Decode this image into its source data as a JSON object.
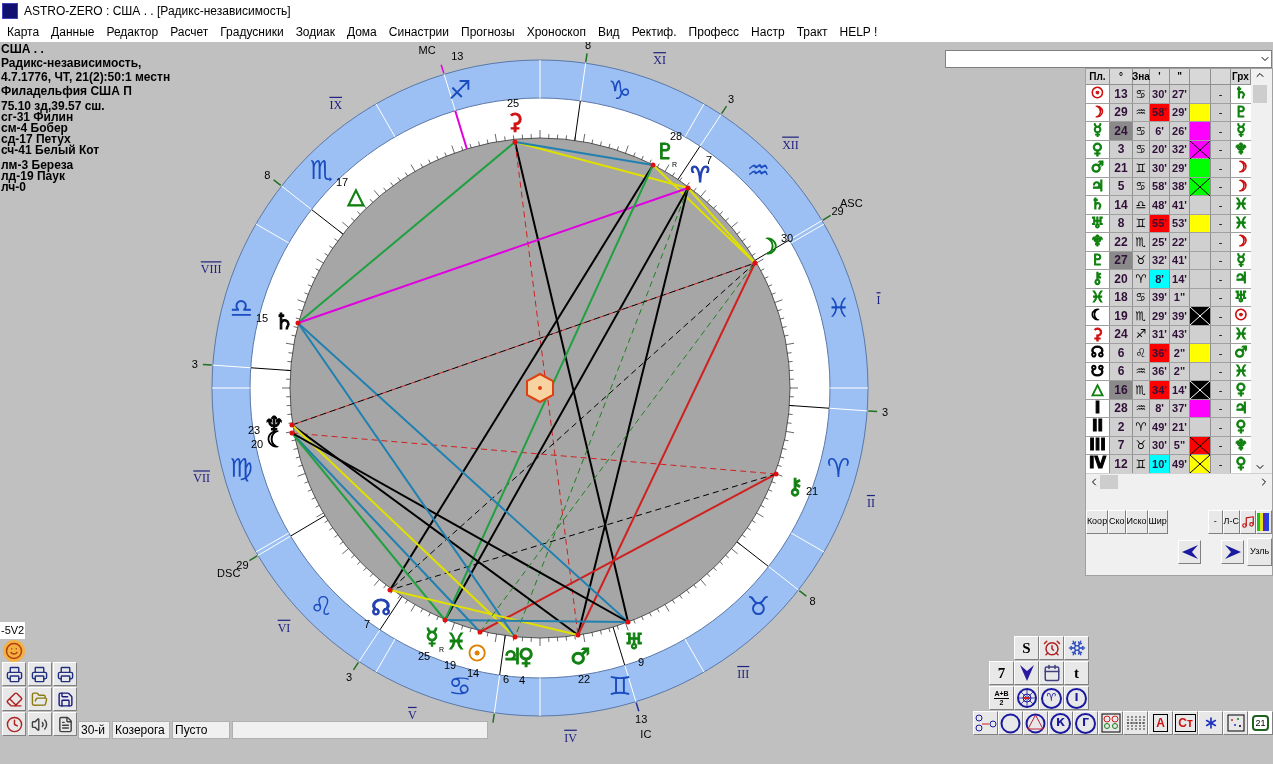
{
  "window": {
    "title": "ASTRO-ZERO : США . . [Радикс-независимость]"
  },
  "menu": [
    "Карта",
    "Данные",
    "Редактор",
    "Расчет",
    "Градусники",
    "Зодиак",
    "Дома",
    "Синастрии",
    "Прогнозы",
    "Хроноскоп",
    "Вид",
    "Ректиф.",
    "Професс",
    "Настр",
    "Тракт",
    "HELP !"
  ],
  "chart_info": {
    "blocks": [
      [
        "США . .",
        "Радикс-независимость,",
        "4.7.1776, ЧТ, 21(2):50:1 местн",
        "Филадельфия США П"
      ],
      [
        "75.10 зд,39.57 сш.",
        "сг-31 Филин",
        "см-4 Бобер",
        "сд-17 Петух",
        "сч-41 Белый Кот"
      ],
      [
        "лм-3 Береза",
        "лд-19 Паук",
        "лч-0"
      ]
    ]
  },
  "wheel": {
    "signs": [
      "♓",
      "♒",
      "♑",
      "♐",
      "♏",
      "♎",
      "♍",
      "♌",
      "♋",
      "♊",
      "♉",
      "♈"
    ],
    "houses": [
      "I",
      "II",
      "III",
      "IV",
      "V",
      "VI",
      "VII",
      "VIII",
      "IX",
      "XI",
      "XII"
    ],
    "cusps": [
      {
        "degree": "29",
        "angle": "ASC"
      },
      {
        "degree": "3"
      },
      {
        "degree": "8"
      },
      {
        "degree": "13",
        "angle": "MC"
      },
      {
        "degree": "8"
      },
      {
        "degree": "3"
      },
      {
        "degree": "29",
        "angle": "DSC"
      },
      {
        "degree": "3"
      },
      {
        "degree": "13",
        "angle": "IC"
      },
      {
        "degree": "8"
      },
      {
        "degree": "3"
      }
    ],
    "planets": [
      {
        "glyph": "⚳",
        "degree": "25",
        "color": "#d01010"
      },
      {
        "glyph": "♇",
        "degree": "28",
        "color": "#108010",
        "mark": "R"
      },
      {
        "glyph": "♈",
        "degree": "7",
        "color": "#2040b0"
      },
      {
        "glyph": "△",
        "degree": "17",
        "color": "#108010"
      },
      {
        "glyph": "☽",
        "degree": "30",
        "color": "#108010"
      },
      {
        "glyph": "♄",
        "degree": "15",
        "color": "#000000"
      },
      {
        "glyph": "♆",
        "degree": "23",
        "color": "#000000"
      },
      {
        "glyph": "☾",
        "degree": "20",
        "color": "#000000"
      },
      {
        "glyph": "⚷",
        "degree": "21",
        "color": "#108010"
      },
      {
        "glyph": "☊",
        "degree": "7",
        "color": "#2040b0"
      },
      {
        "glyph": "☿",
        "degree": "25",
        "color": "#108010",
        "mark": "R"
      },
      {
        "glyph": "♓",
        "degree": "19",
        "color": "#108010"
      },
      {
        "glyph": "☉",
        "degree": "14",
        "color": "#e08000"
      },
      {
        "glyph": "♃",
        "degree": "6",
        "color": "#108010"
      },
      {
        "glyph": "♀",
        "degree": "4",
        "color": "#108010"
      },
      {
        "glyph": "♂",
        "degree": "22",
        "color": "#108010"
      },
      {
        "glyph": "♅",
        "degree": "9",
        "color": "#108010"
      }
    ]
  },
  "planet_table": {
    "columns": [
      "Пл.",
      "°",
      "Зна",
      "'",
      "\"",
      "Грх"
    ],
    "rows": [
      {
        "planet": {
          "glyph": "☉",
          "color": "#d01010"
        },
        "degree": {
          "text": "13",
          "marked": false
        },
        "sign": "♋",
        "minutes": {
          "text": "30'"
        },
        "seconds": "27'",
        "dash": "-",
        "aspect": {
          "glyph": "♄",
          "color": "#108010"
        }
      },
      {
        "planet": {
          "glyph": "☽",
          "color": "#d01010"
        },
        "degree": {
          "text": "29",
          "marked": false
        },
        "sign": "♒",
        "minutes": {
          "text": "58'",
          "color": "#ff0000"
        },
        "seconds": "29'",
        "marker": {
          "color": "#ffff00",
          "crossed": false
        },
        "dash": "-",
        "aspect": {
          "glyph": "♇",
          "color": "#108010"
        }
      },
      {
        "planet": {
          "glyph": "☿",
          "color": "#108010"
        },
        "degree": {
          "text": "24",
          "marked": true
        },
        "sign": "♋",
        "minutes": {
          "text": "6'"
        },
        "seconds": "26'",
        "marker": {
          "color": "#ff00ff",
          "crossed": false
        },
        "dash": "-",
        "aspect": {
          "glyph": "☿",
          "color": "#108010"
        }
      },
      {
        "planet": {
          "glyph": "♀",
          "color": "#108010"
        },
        "degree": {
          "text": "3",
          "marked": false
        },
        "sign": "♋",
        "minutes": {
          "text": "20'"
        },
        "seconds": "32'",
        "marker": {
          "color": "#ff00ff",
          "crossed": true
        },
        "dash": "-",
        "aspect": {
          "glyph": "♆",
          "color": "#108010"
        }
      },
      {
        "planet": {
          "glyph": "♂",
          "color": "#108010"
        },
        "degree": {
          "text": "21",
          "marked": false
        },
        "sign": "♊",
        "minutes": {
          "text": "30'"
        },
        "seconds": "29'",
        "marker": {
          "color": "#00ff00",
          "crossed": false
        },
        "dash": "-",
        "aspect": {
          "glyph": "☽",
          "color": "#d01010"
        }
      },
      {
        "planet": {
          "glyph": "♃",
          "color": "#108010"
        },
        "degree": {
          "text": "5",
          "marked": false
        },
        "sign": "♋",
        "minutes": {
          "text": "58'"
        },
        "seconds": "38'",
        "marker": {
          "color": "#00ff00",
          "crossed": true
        },
        "dash": "-",
        "aspect": {
          "glyph": "☽",
          "color": "#d01010"
        }
      },
      {
        "planet": {
          "glyph": "♄",
          "color": "#108010"
        },
        "degree": {
          "text": "14",
          "marked": false
        },
        "sign": "♎",
        "minutes": {
          "text": "48'"
        },
        "seconds": "41'",
        "dash": "-",
        "aspect": {
          "glyph": "♓",
          "color": "#108010"
        }
      },
      {
        "planet": {
          "glyph": "♅",
          "color": "#108010"
        },
        "degree": {
          "text": "8",
          "marked": false
        },
        "sign": "♊",
        "minutes": {
          "text": "55'",
          "color": "#ff0000"
        },
        "seconds": "53'",
        "marker": {
          "color": "#ffff00",
          "crossed": false
        },
        "dash": "-",
        "aspect": {
          "glyph": "♓",
          "color": "#108010"
        }
      },
      {
        "planet": {
          "glyph": "♆",
          "color": "#108010"
        },
        "degree": {
          "text": "22",
          "marked": false
        },
        "sign": "♏",
        "minutes": {
          "text": "25'"
        },
        "seconds": "22'",
        "dash": "-",
        "aspect": {
          "glyph": "☽",
          "color": "#d01010"
        }
      },
      {
        "planet": {
          "glyph": "♇",
          "color": "#108010"
        },
        "degree": {
          "text": "27",
          "marked": true
        },
        "sign": "♉",
        "minutes": {
          "text": "32'"
        },
        "seconds": "41'",
        "dash": "-",
        "aspect": {
          "glyph": "☿",
          "color": "#108010"
        }
      },
      {
        "planet": {
          "glyph": "⚷",
          "color": "#108010"
        },
        "degree": {
          "text": "20",
          "marked": false
        },
        "sign": "♈",
        "minutes": {
          "text": "8'",
          "color": "#00ffff"
        },
        "seconds": "14'",
        "dash": "-",
        "aspect": {
          "glyph": "♃",
          "color": "#108010"
        }
      },
      {
        "planet": {
          "glyph": "♓",
          "color": "#108010"
        },
        "degree": {
          "text": "18",
          "marked": false
        },
        "sign": "♋",
        "minutes": {
          "text": "39'"
        },
        "seconds": "1\"",
        "dash": "-",
        "aspect": {
          "glyph": "♅",
          "color": "#108010"
        }
      },
      {
        "planet": {
          "glyph": "☾",
          "color": "#000000"
        },
        "degree": {
          "text": "19",
          "marked": false
        },
        "sign": "♏",
        "minutes": {
          "text": "29'"
        },
        "seconds": "39'",
        "marker": {
          "color": "#000000",
          "crossed": true
        },
        "dash": "-",
        "aspect": {
          "glyph": "☉",
          "color": "#d01010"
        }
      },
      {
        "planet": {
          "glyph": "⚳",
          "color": "#d01010"
        },
        "degree": {
          "text": "24",
          "marked": false
        },
        "sign": "♐",
        "minutes": {
          "text": "31'"
        },
        "seconds": "43'",
        "dash": "-",
        "aspect": {
          "glyph": "♓",
          "color": "#108010"
        }
      },
      {
        "planet": {
          "glyph": "☊",
          "color": "#000000"
        },
        "degree": {
          "text": "6",
          "marked": false
        },
        "sign": "♌",
        "minutes": {
          "text": "36'",
          "color": "#ff0000"
        },
        "seconds": "2\"",
        "marker": {
          "color": "#ffff00",
          "crossed": false
        },
        "dash": "-",
        "aspect": {
          "glyph": "♂",
          "color": "#108010"
        }
      },
      {
        "planet": {
          "glyph": "☋",
          "color": "#000000"
        },
        "degree": {
          "text": "6",
          "marked": false
        },
        "sign": "♒",
        "minutes": {
          "text": "36'"
        },
        "seconds": "2\"",
        "dash": "-",
        "aspect": {
          "glyph": "♓",
          "color": "#108010"
        }
      },
      {
        "planet": {
          "glyph": "△",
          "color": "#108010"
        },
        "degree": {
          "text": "16",
          "marked": true
        },
        "sign": "♏",
        "minutes": {
          "text": "34'",
          "color": "#ff0000"
        },
        "seconds": "14'",
        "marker": {
          "color": "#000000",
          "crossed": true
        },
        "dash": "-",
        "aspect": {
          "glyph": "♀",
          "color": "#108010"
        }
      },
      {
        "planet": {
          "glyph": "I",
          "color": "#000000"
        },
        "degree": {
          "text": "28",
          "marked": false
        },
        "sign": "♒",
        "minutes": {
          "text": "8'"
        },
        "seconds": "37'",
        "marker": {
          "color": "#ff00ff",
          "crossed": false
        },
        "dash": "-",
        "aspect": {
          "glyph": "♃",
          "color": "#108010"
        }
      },
      {
        "planet": {
          "glyph": "II",
          "color": "#000000"
        },
        "degree": {
          "text": "2",
          "marked": false
        },
        "sign": "♈",
        "minutes": {
          "text": "49'"
        },
        "seconds": "21'",
        "dash": "-",
        "aspect": {
          "glyph": "♀",
          "color": "#108010"
        }
      },
      {
        "planet": {
          "glyph": "III",
          "color": "#000000"
        },
        "degree": {
          "text": "7",
          "marked": false
        },
        "sign": "♉",
        "minutes": {
          "text": "30'"
        },
        "seconds": "5\"",
        "marker": {
          "color": "#ff0000",
          "crossed": true
        },
        "dash": "-",
        "aspect": {
          "glyph": "♆",
          "color": "#108010"
        }
      },
      {
        "planet": {
          "glyph": "IV",
          "color": "#000000"
        },
        "degree": {
          "text": "12",
          "marked": false
        },
        "sign": "♊",
        "minutes": {
          "text": "10'",
          "color": "#00ffff"
        },
        "seconds": "49'",
        "marker": {
          "color": "#ffff00",
          "crossed": true
        },
        "dash": "-",
        "aspect": {
          "glyph": "♀",
          "color": "#108010"
        }
      }
    ]
  },
  "table_buttons": [
    {
      "kind": "text",
      "label": "Коор"
    },
    {
      "kind": "text",
      "label": "Ско"
    },
    {
      "kind": "text",
      "label": "Иско"
    },
    {
      "kind": "text",
      "label": "Шир"
    },
    {
      "kind": "text",
      "label": "-"
    },
    {
      "kind": "text",
      "label": "Л-С"
    },
    {
      "kind": "music"
    },
    {
      "kind": "rainbow"
    }
  ],
  "nav_buttons": [
    {
      "kind": "prev"
    },
    {
      "kind": "next"
    },
    {
      "kind": "text",
      "label": "Узль"
    }
  ],
  "version": "-5V2",
  "left_tools": [
    {
      "kind": "print"
    },
    {
      "kind": "print"
    },
    {
      "kind": "print"
    },
    {
      "kind": "eraser"
    },
    {
      "kind": "folder"
    },
    {
      "kind": "save"
    },
    {
      "kind": "clock"
    },
    {
      "kind": "speaker"
    },
    {
      "kind": "notes"
    }
  ],
  "status": [
    "30-й",
    "Козерога",
    "Пусто"
  ],
  "toolbar": [
    [
      {
        "kind": "text",
        "label": "S"
      },
      {
        "kind": "alarm"
      },
      {
        "kind": "snowflake"
      }
    ],
    [
      {
        "kind": "text",
        "label": "7"
      },
      {
        "kind": "arrow"
      },
      {
        "kind": "calendar"
      },
      {
        "kind": "text",
        "label": "t"
      }
    ],
    [
      {
        "kind": "fraction",
        "label": "A+B",
        "label2": "2"
      },
      {
        "kind": "wheel"
      },
      {
        "kind": "circle-text",
        "label": "♈"
      },
      {
        "kind": "circle-text",
        "label": "I"
      }
    ],
    [
      {
        "kind": "nodes"
      },
      {
        "kind": "circle"
      },
      {
        "kind": "triangle"
      },
      {
        "kind": "circle-text",
        "label": "К"
      },
      {
        "kind": "circle-text",
        "label": "Г"
      },
      {
        "kind": "planets"
      },
      {
        "kind": "grid"
      },
      {
        "kind": "red-text",
        "label": "A"
      },
      {
        "kind": "red-text",
        "label": "Ст"
      },
      {
        "kind": "star"
      },
      {
        "kind": "dots"
      },
      {
        "kind": "day",
        "label": "21"
      }
    ]
  ]
}
